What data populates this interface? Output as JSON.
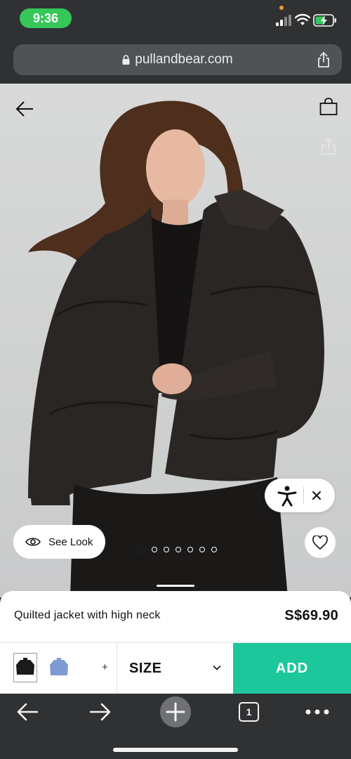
{
  "status_bar": {
    "time": "9:36"
  },
  "browser": {
    "url": "pullandbear.com"
  },
  "product": {
    "name": "Quilted jacket with high neck",
    "price": "S$69.90",
    "see_look_label": "See Look",
    "gallery": {
      "total_images": 7,
      "active_index": 0
    },
    "colors": [
      {
        "name": "black",
        "hex": "#1c1a19",
        "selected": true
      },
      {
        "name": "blue",
        "hex": "#7f9bd3",
        "selected": false
      }
    ],
    "more_colors_label": "+",
    "size_label": "SIZE",
    "add_label": "ADD"
  },
  "toolbar": {
    "tab_count": "1"
  },
  "icons": [
    "back-arrow-icon",
    "bag-icon",
    "share-icon",
    "accessibility-icon",
    "close-icon",
    "eye-icon",
    "heart-icon",
    "chevron-down-icon",
    "lock-icon",
    "forward-arrow-icon",
    "plus-icon",
    "more-icon"
  ],
  "colors": {
    "accent": "#1dc79c",
    "chrome": "#2f3133",
    "time_pill": "#35c759"
  }
}
